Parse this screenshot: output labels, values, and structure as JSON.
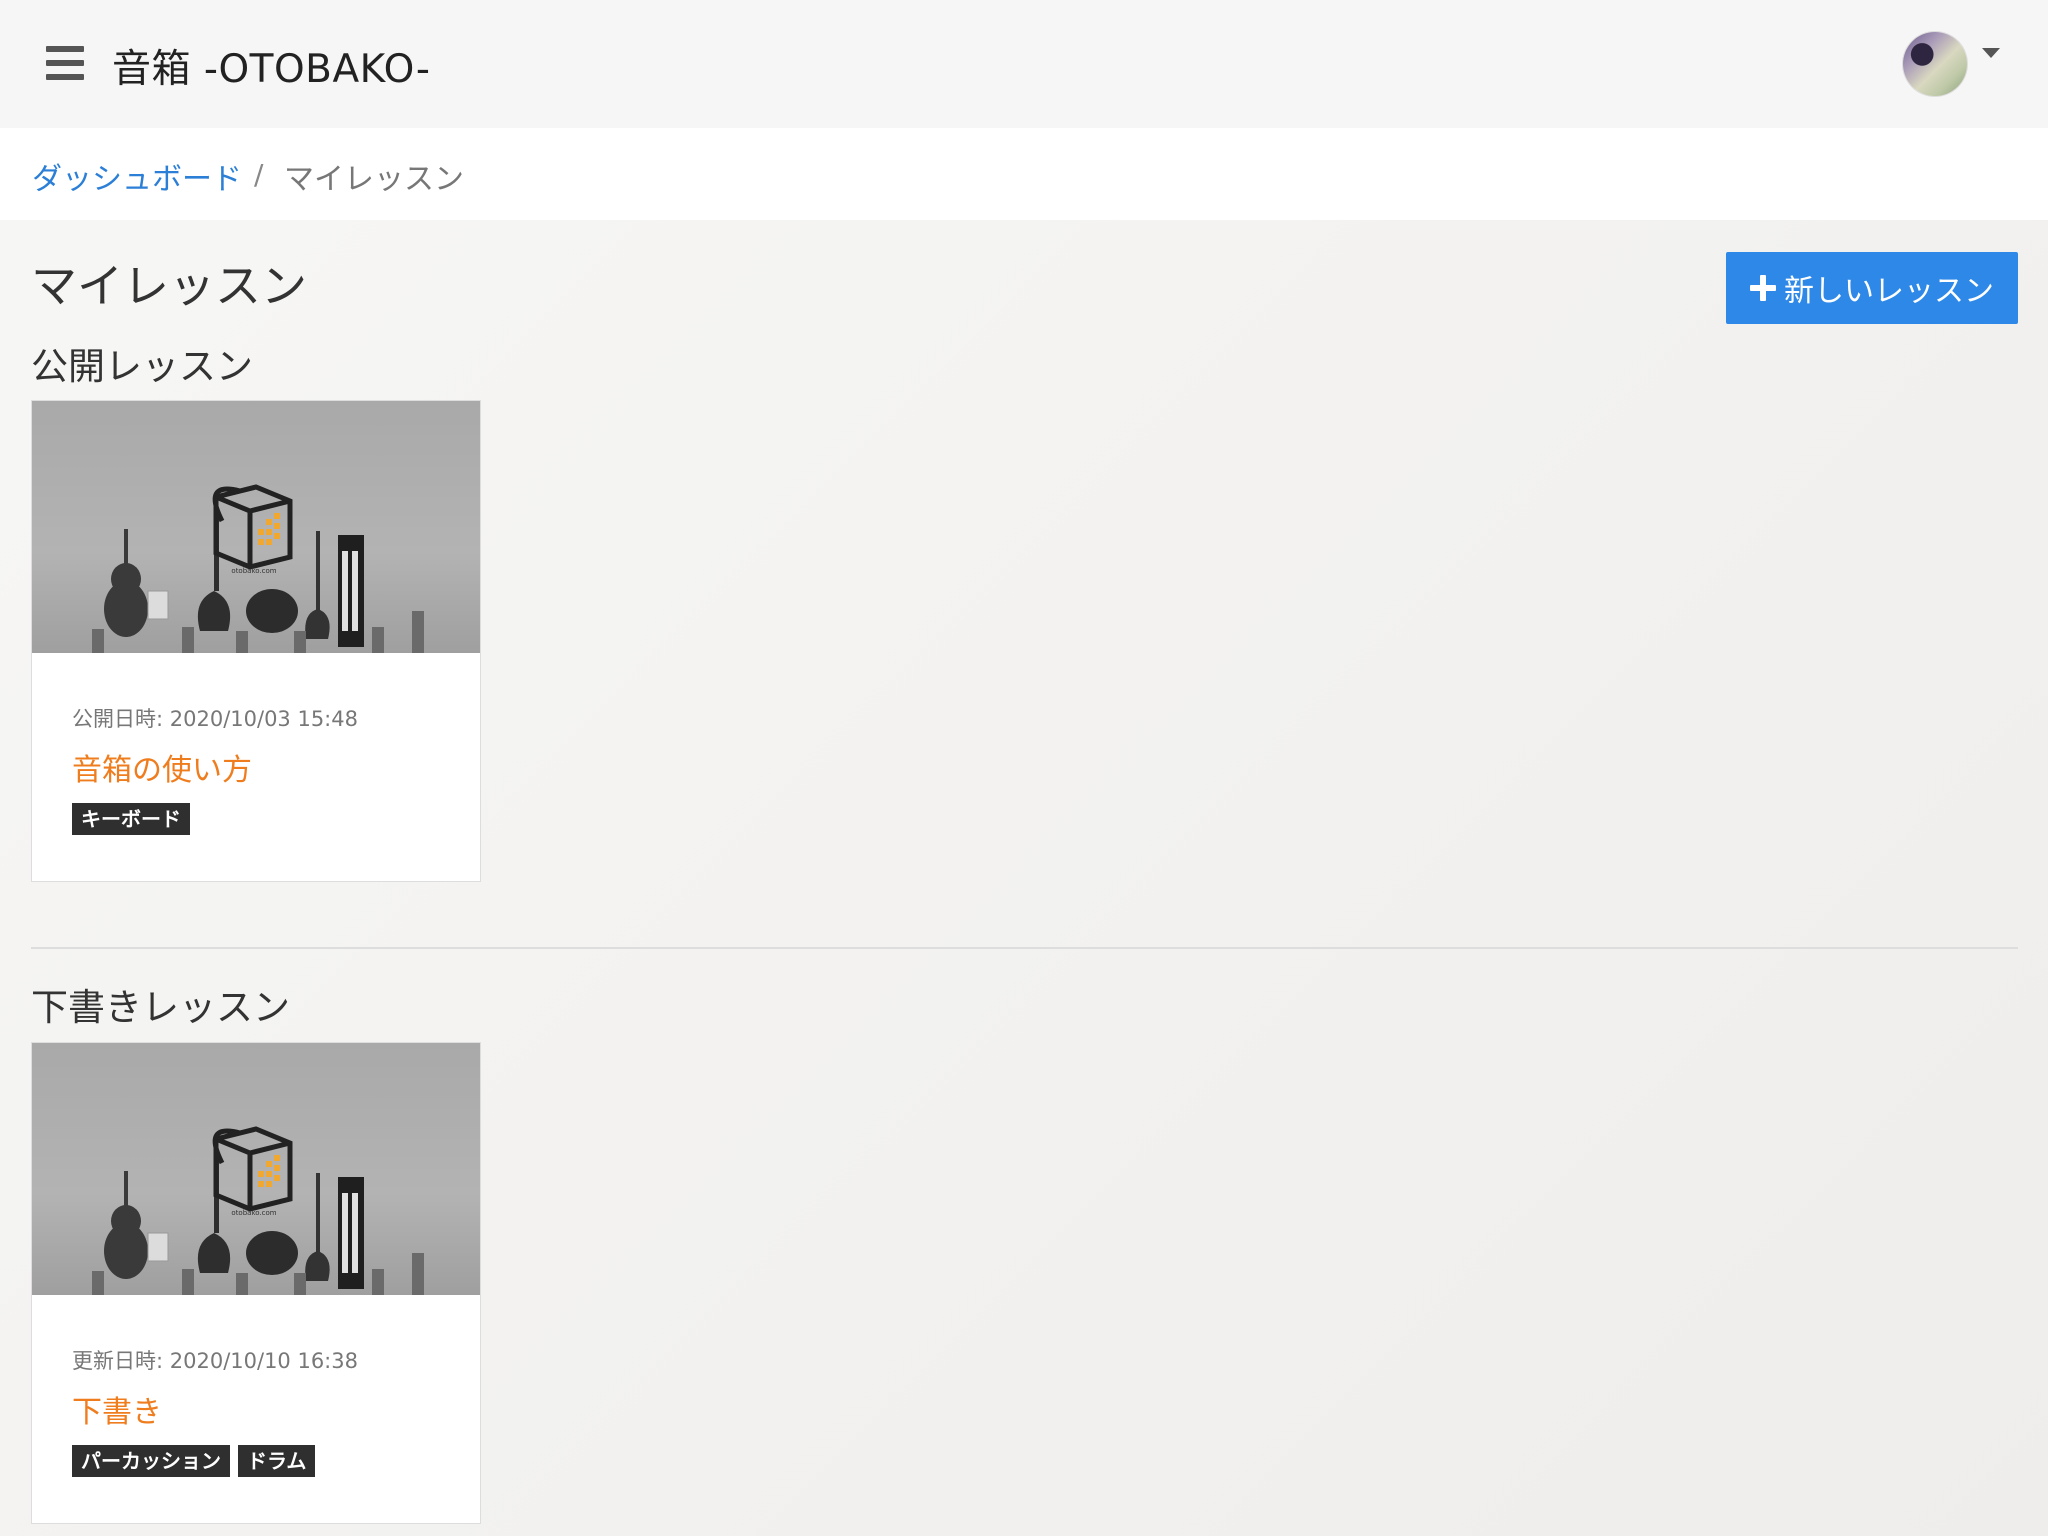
{
  "header": {
    "app_title": "音箱 -OTOBAKO-"
  },
  "breadcrumb": {
    "home": "ダッシュボード",
    "separator": "/",
    "current": "マイレッスン"
  },
  "page": {
    "title": "マイレッスン",
    "new_button_label": "新しいレッスン"
  },
  "sections": {
    "public": {
      "title": "公開レッスン",
      "cards": [
        {
          "date": "公開日時: 2020/10/03 15:48",
          "title": "音箱の使い方",
          "tags": [
            "キーボード"
          ],
          "image_caption": "otobako.com"
        }
      ]
    },
    "draft": {
      "title": "下書きレッスン",
      "cards": [
        {
          "date": "更新日時: 2020/10/10 16:38",
          "title": "下書き",
          "tags": [
            "パーカッション",
            "ドラム"
          ],
          "image_caption": "otobako.com"
        }
      ]
    }
  },
  "colors": {
    "accent": "#2e88e8",
    "link": "#2b7fd6",
    "card_title": "#ef7d1e",
    "tag_bg": "#2f2f2f"
  },
  "icons": {
    "menu": "hamburger-icon",
    "add": "plus-icon",
    "dropdown": "caret-down-icon"
  }
}
